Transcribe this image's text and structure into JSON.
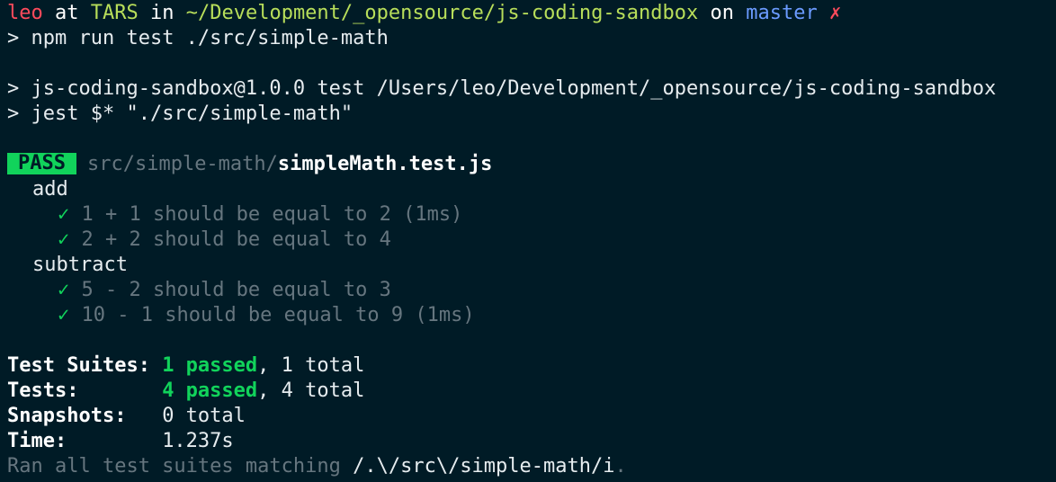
{
  "prompt": {
    "user": "leo",
    "at": "at",
    "host": "TARS",
    "in": "in",
    "path": "~/Development/_opensource/js-coding-sandbox",
    "on": "on",
    "branch": "master",
    "dirty_marker": "✗"
  },
  "command": {
    "prompt_symbol": ">",
    "text": "npm run test ./src/simple-math"
  },
  "npm_output": [
    {
      "symbol": ">",
      "text": "js-coding-sandbox@1.0.0 test /Users/leo/Development/_opensource/js-coding-sandbox"
    },
    {
      "symbol": ">",
      "text": "jest $* \"./src/simple-math\""
    }
  ],
  "result": {
    "badge": "PASS",
    "path_dir": "src/simple-math/",
    "file": "simpleMath.test.js"
  },
  "groups": [
    {
      "name": "add",
      "tests": [
        {
          "check": "✓",
          "text": "1 + 1 should be equal to 2 (1ms)"
        },
        {
          "check": "✓",
          "text": "2 + 2 should be equal to 4"
        }
      ]
    },
    {
      "name": "subtract",
      "tests": [
        {
          "check": "✓",
          "text": "5 - 2 should be equal to 3"
        },
        {
          "check": "✓",
          "text": "10 - 1 should be equal to 9 (1ms)"
        }
      ]
    }
  ],
  "summary": {
    "suites_label": "Test Suites: ",
    "suites_passed": "1 passed",
    "suites_total": ", 1 total",
    "tests_label": "Tests:       ",
    "tests_passed": "4 passed",
    "tests_total": ", 4 total",
    "snapshots_label": "Snapshots:   ",
    "snapshots_value": "0 total",
    "time_label": "Time:        ",
    "time_value": "1.237s",
    "ran_prefix": "Ran all test suites matching ",
    "ran_pattern": "/.\\/src\\/simple-math/i",
    "ran_suffix": "."
  },
  "colors": {
    "background": "#001b26",
    "pass": "#11d35b",
    "error": "#ff4b5c",
    "path": "#b8de5a",
    "branch": "#6b9bff"
  }
}
